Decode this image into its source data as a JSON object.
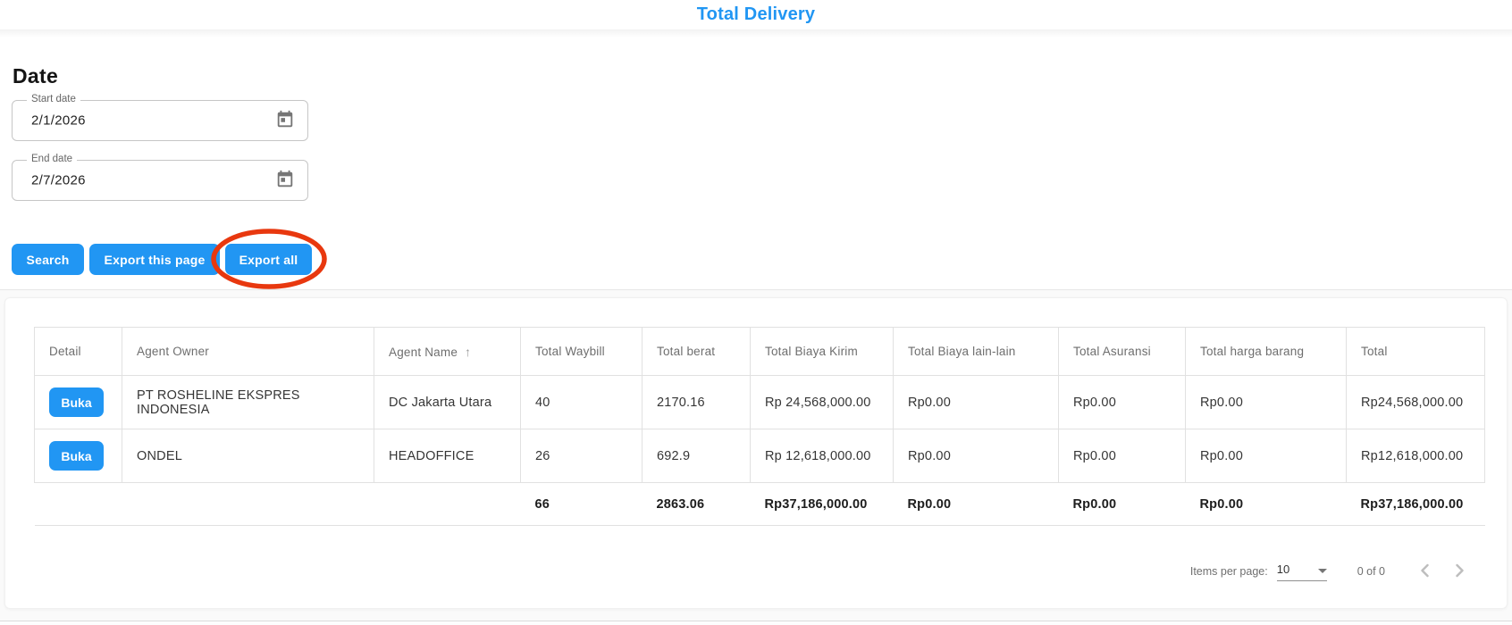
{
  "header": {
    "title": "Total Delivery"
  },
  "filters": {
    "section_title": "Date",
    "start_date": {
      "label": "Start date",
      "value": "2/1/2026"
    },
    "end_date": {
      "label": "End date",
      "value": "2/7/2026"
    }
  },
  "actions": {
    "search": "Search",
    "export_page": "Export this page",
    "export_all": "Export all"
  },
  "annotation": {
    "shape": "ellipse",
    "color": "#e8380f",
    "target": "export-all-button"
  },
  "table": {
    "columns": [
      "Detail",
      "Agent Owner",
      "Agent Name",
      "Total Waybill",
      "Total berat",
      "Total Biaya Kirim",
      "Total Biaya lain-lain",
      "Total Asuransi",
      "Total harga barang",
      "Total"
    ],
    "sorted_column": "Agent Name",
    "sort_direction": "asc",
    "sort_icon": "↑",
    "detail_button_label": "Buka",
    "rows": [
      {
        "agent_owner": "PT ROSHELINE EKSPRES INDONESIA",
        "agent_name": "DC Jakarta Utara",
        "total_waybill": "40",
        "total_berat": "2170.16",
        "total_biaya_kirim": "Rp 24,568,000.00",
        "total_biaya_lain": "Rp0.00",
        "total_asuransi": "Rp0.00",
        "total_harga_barang": "Rp0.00",
        "total": "Rp24,568,000.00"
      },
      {
        "agent_owner": "ONDEL",
        "agent_name": "HEADOFFICE",
        "total_waybill": "26",
        "total_berat": "692.9",
        "total_biaya_kirim": "Rp 12,618,000.00",
        "total_biaya_lain": "Rp0.00",
        "total_asuransi": "Rp0.00",
        "total_harga_barang": "Rp0.00",
        "total": "Rp12,618,000.00"
      }
    ],
    "footer": {
      "total_waybill": "66",
      "total_berat": "2863.06",
      "total_biaya_kirim": "Rp37,186,000.00",
      "total_biaya_lain": "Rp0.00",
      "total_asuransi": "Rp0.00",
      "total_harga_barang": "Rp0.00",
      "total": "Rp37,186,000.00"
    }
  },
  "paginator": {
    "items_per_page_label": "Items per page:",
    "page_size": "10",
    "range_label": "0 of 0"
  },
  "colors": {
    "accent": "#2196f3",
    "annotation_red": "#e8380f"
  }
}
